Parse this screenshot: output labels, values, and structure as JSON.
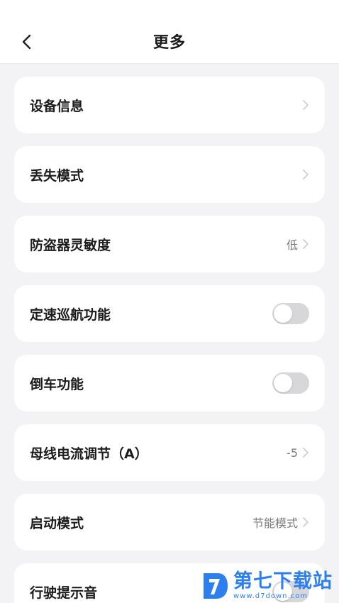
{
  "header": {
    "title": "更多",
    "back_icon": "chevron-left-icon"
  },
  "items": [
    {
      "label": "设备信息",
      "value": "",
      "control": "chevron"
    },
    {
      "label": "丢失模式",
      "value": "",
      "control": "chevron"
    },
    {
      "label": "防盗器灵敏度",
      "value": "低",
      "control": "chevron"
    },
    {
      "label": "定速巡航功能",
      "value": "",
      "control": "toggle",
      "toggle_on": false
    },
    {
      "label": "倒车功能",
      "value": "",
      "control": "toggle",
      "toggle_on": false
    },
    {
      "label": "母线电流调节（A）",
      "value": "-5",
      "control": "chevron"
    },
    {
      "label": "启动模式",
      "value": "节能模式",
      "control": "chevron"
    },
    {
      "label": "行驶提示音",
      "value": "",
      "control": "toggle",
      "toggle_on": false
    }
  ],
  "watermark": {
    "name": "第七下载站",
    "url": "www.d7down.com"
  },
  "colors": {
    "background": "#f3f3f5",
    "card": "#ffffff",
    "toggle_off": "#d7d7da",
    "watermark": "#2d7ff0"
  }
}
